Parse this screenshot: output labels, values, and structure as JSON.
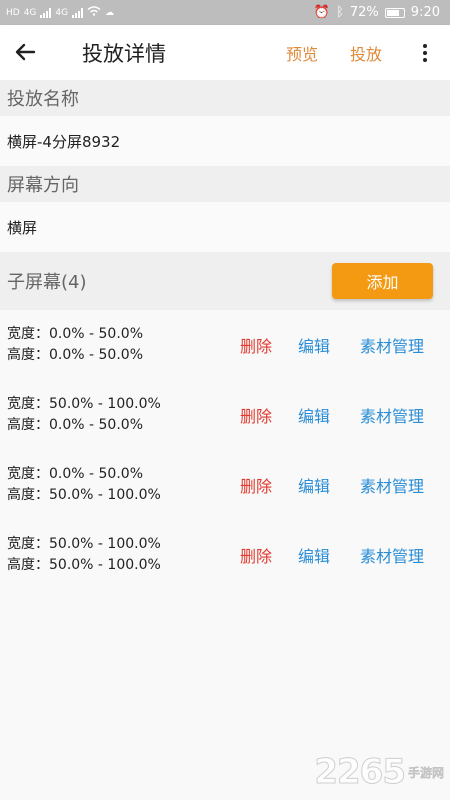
{
  "status_bar": {
    "net_left": "4G",
    "net_right": "4G",
    "battery": "72%",
    "time": "9:20"
  },
  "app_bar": {
    "back_icon": "arrow-left-icon",
    "title": "投放详情",
    "preview_label": "预览",
    "cast_label": "投放",
    "more_icon": "more-vertical-icon"
  },
  "cast_name": {
    "header": "投放名称",
    "value": "横屏-4分屏8932"
  },
  "orientation": {
    "header": "屏幕方向",
    "value": "横屏"
  },
  "sub_screens": {
    "header": "子屏幕(4)",
    "add_label": "添加",
    "items": [
      {
        "width": "宽度：0.0% - 50.0%",
        "height": "高度：0.0% - 50.0%",
        "delete": "删除",
        "edit": "编辑",
        "materials": "素材管理"
      },
      {
        "width": "宽度：50.0% - 100.0%",
        "height": "高度：0.0% - 50.0%",
        "delete": "删除",
        "edit": "编辑",
        "materials": "素材管理"
      },
      {
        "width": "宽度：0.0% - 50.0%",
        "height": "高度：50.0% - 100.0%",
        "delete": "删除",
        "edit": "编辑",
        "materials": "素材管理"
      },
      {
        "width": "宽度：50.0% - 100.0%",
        "height": "高度：50.0% - 100.0%",
        "delete": "删除",
        "edit": "编辑",
        "materials": "素材管理"
      }
    ]
  },
  "watermark": {
    "number": "2265",
    "text": "手游网"
  },
  "colors": {
    "accent_orange": "#f39a12",
    "action_orange": "#e08a3a",
    "delete_red": "#e0392f",
    "link_blue": "#2a8dd6"
  }
}
